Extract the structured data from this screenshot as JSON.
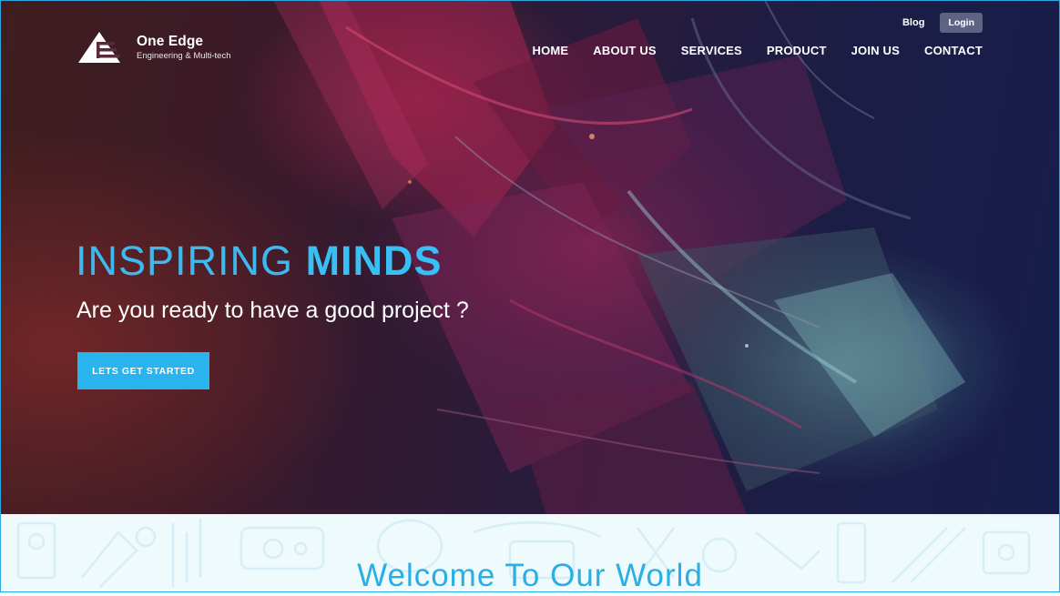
{
  "brand": {
    "name": "One Edge",
    "tagline": "Engineering & Multi-tech"
  },
  "top_links": {
    "blog": "Blog",
    "login": "Login"
  },
  "nav": {
    "items": [
      "HOME",
      "ABOUT US",
      "SERVICES",
      "PRODUCT",
      "JOIN US",
      "CONTACT"
    ]
  },
  "hero": {
    "headline_light": "INSPIRING",
    "headline_bold": "MINDS",
    "subheadline": "Are you ready to have a good project ?",
    "cta_label": "LETS GET STARTED"
  },
  "welcome": {
    "title": "Welcome To Our World"
  },
  "colors": {
    "accent": "#29b4ee",
    "login_button": "#5e6384",
    "hero_dark": "#161d4a"
  },
  "icons": [
    "logo-triangle-icon",
    "tools-doodle-icons"
  ]
}
